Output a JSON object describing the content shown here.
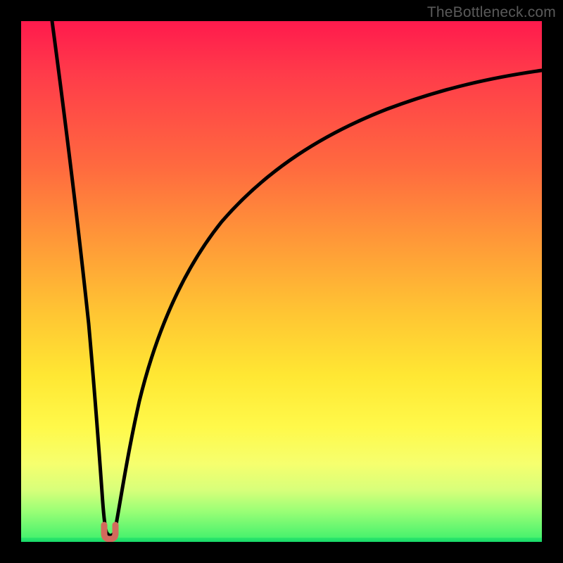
{
  "watermark": "TheBottleneck.com",
  "colors": {
    "background": "#000000",
    "curve_stroke": "#000000",
    "marker_fill": "#d26a5c",
    "marker_stroke": "#b95247",
    "gradient_top": "#ff1a4d",
    "gradient_bottom": "#3bf06c"
  },
  "chart_data": {
    "type": "line",
    "title": "",
    "xlabel": "",
    "ylabel": "",
    "xlim": [
      0,
      100
    ],
    "ylim": [
      0,
      100
    ],
    "grid": false,
    "legend": false,
    "series": [
      {
        "name": "left-branch",
        "x": [
          6,
          8,
          10,
          12,
          13.5,
          14.5,
          15.5,
          16
        ],
        "y": [
          100,
          82,
          62,
          40,
          24,
          12,
          4,
          2
        ]
      },
      {
        "name": "right-branch",
        "x": [
          18,
          19,
          20,
          22,
          25,
          30,
          37,
          45,
          55,
          66,
          78,
          90,
          100
        ],
        "y": [
          2,
          5,
          10,
          20,
          32,
          46,
          58,
          67,
          74,
          80,
          84.5,
          88,
          90.5
        ]
      }
    ],
    "markers": [
      {
        "name": "valley-marker-left",
        "x": 16.0,
        "y": 2.2
      },
      {
        "name": "valley-marker-right",
        "x": 18.0,
        "y": 2.2
      }
    ],
    "notes": "Values estimated from pixel positions; y is percent of plot height from bottom, x is percent of plot width from left."
  }
}
